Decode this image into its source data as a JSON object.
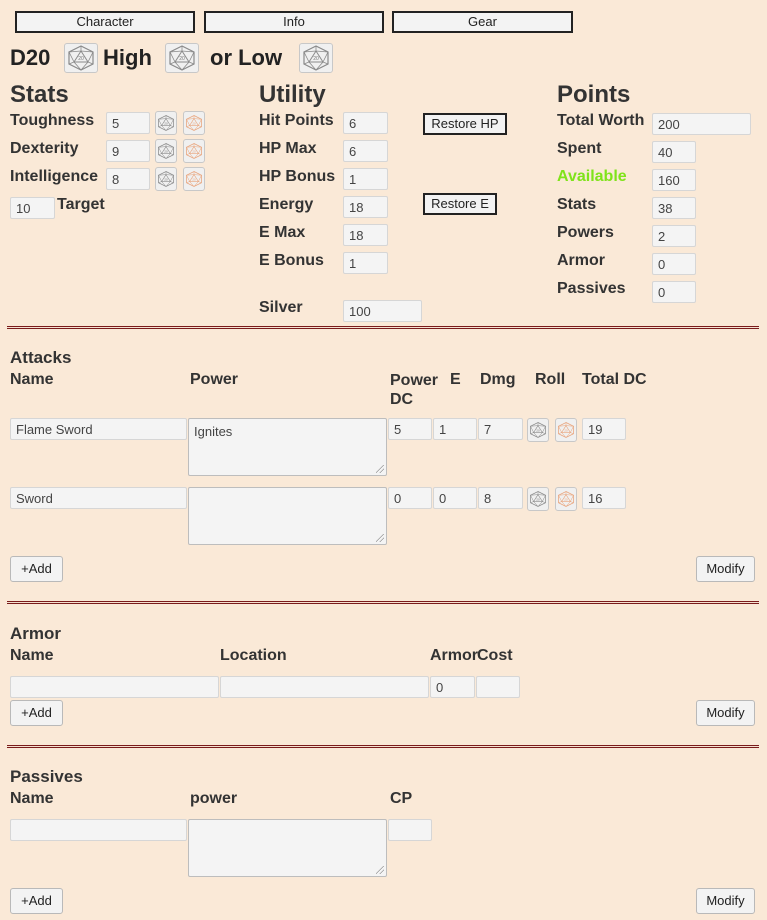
{
  "tabs": [
    "Character",
    "Info",
    "Gear"
  ],
  "roll_header": {
    "d20": "D20",
    "high": "High",
    "or_low": "or Low"
  },
  "stats": {
    "title": "Stats",
    "rows": [
      {
        "label": "Toughness",
        "value": "5"
      },
      {
        "label": "Dexterity",
        "value": "9"
      },
      {
        "label": "Intelligence",
        "value": "8"
      }
    ],
    "target_value": "10",
    "target_label": "Target"
  },
  "utility": {
    "title": "Utility",
    "hit_points": {
      "label": "Hit Points",
      "value": "6"
    },
    "hp_max": {
      "label": "HP Max",
      "value": "6"
    },
    "hp_bonus": {
      "label": "HP Bonus",
      "value": "1"
    },
    "energy": {
      "label": "Energy",
      "value": "18"
    },
    "e_max": {
      "label": "E Max",
      "value": "18"
    },
    "e_bonus": {
      "label": "E Bonus",
      "value": "1"
    },
    "silver": {
      "label": "Silver",
      "value": "100"
    },
    "restore_hp": "Restore HP",
    "restore_e": "Restore E"
  },
  "points": {
    "title": "Points",
    "total_worth": {
      "label": "Total Worth",
      "value": "200"
    },
    "spent": {
      "label": "Spent",
      "value": "40"
    },
    "available": {
      "label": "Available",
      "value": "160",
      "color": "#7fe31a"
    },
    "stats": {
      "label": "Stats",
      "value": "38"
    },
    "powers": {
      "label": "Powers",
      "value": "2"
    },
    "armor": {
      "label": "Armor",
      "value": "0"
    },
    "passives": {
      "label": "Passives",
      "value": "0"
    }
  },
  "attacks": {
    "title": "Attacks",
    "headers": {
      "name": "Name",
      "power": "Power",
      "power_dc": "Power DC",
      "e": "E",
      "dmg": "Dmg",
      "roll": "Roll",
      "total_dc": "Total DC"
    },
    "rows": [
      {
        "name": "Flame Sword",
        "power": "Ignites",
        "power_dc": "5",
        "e": "1",
        "dmg": "7",
        "total_dc": "19"
      },
      {
        "name": "Sword",
        "power": "",
        "power_dc": "0",
        "e": "0",
        "dmg": "8",
        "total_dc": "16"
      }
    ],
    "add_label": "+Add",
    "modify_label": "Modify"
  },
  "armor": {
    "title": "Armor",
    "headers": {
      "name": "Name",
      "location": "Location",
      "armor": "Armor",
      "cost": "Cost"
    },
    "row": {
      "name": "",
      "location": "",
      "armor": "0",
      "cost": ""
    },
    "add_label": "+Add",
    "modify_label": "Modify"
  },
  "passives": {
    "title": "Passives",
    "headers": {
      "name": "Name",
      "power": "power",
      "cp": "CP"
    },
    "row": {
      "name": "",
      "power": "",
      "cp": ""
    },
    "add_label": "+Add",
    "modify_label": "Modify"
  },
  "icons": {
    "die_gray": "#8a8a8a",
    "die_orange": "#e9a37a"
  }
}
